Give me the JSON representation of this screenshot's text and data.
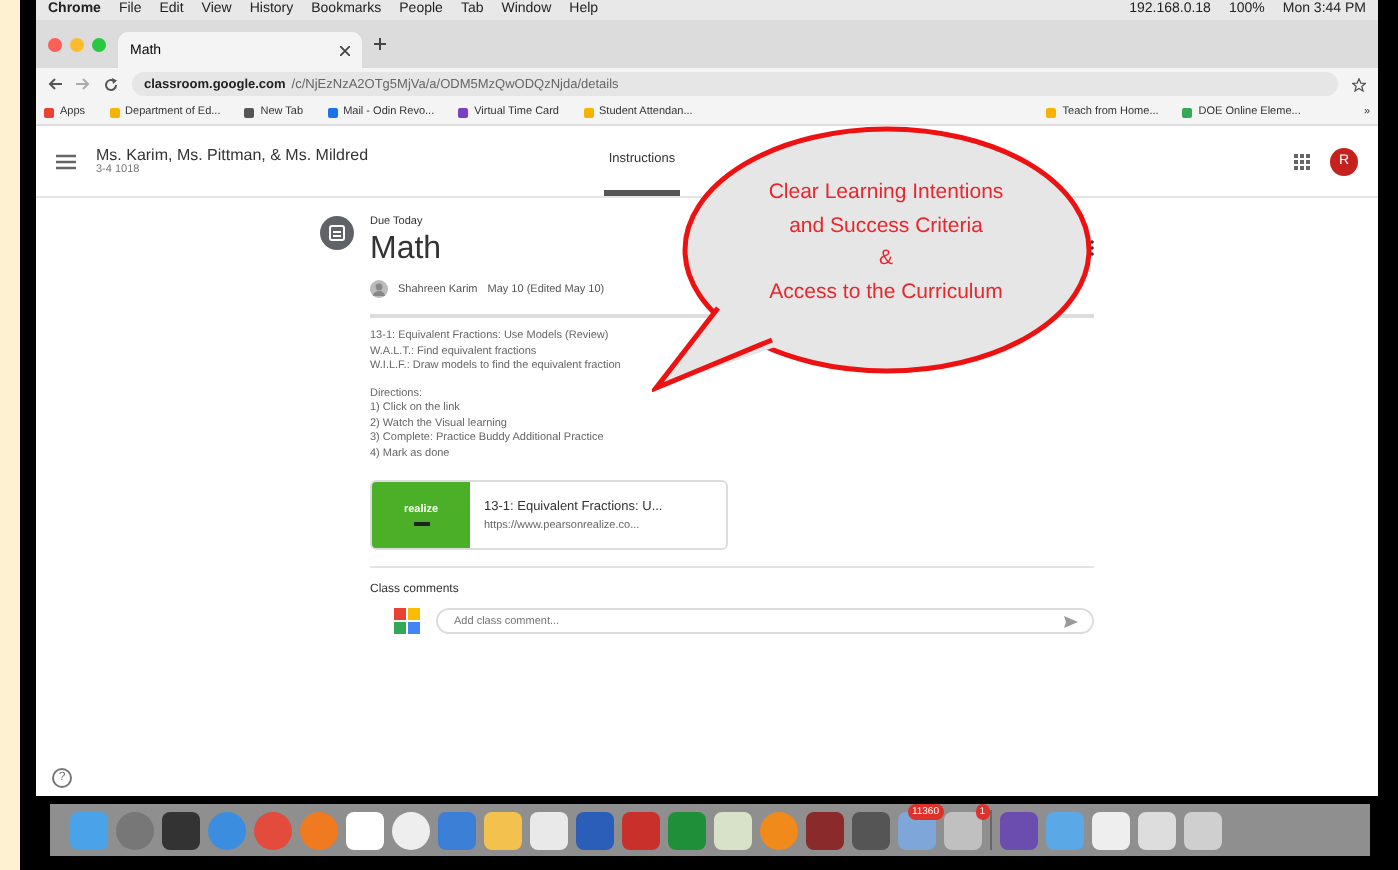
{
  "menu_bar": {
    "items": [
      "Chrome",
      "File",
      "Edit",
      "View",
      "History",
      "Bookmarks",
      "People",
      "Tab",
      "Window",
      "Help"
    ],
    "status": [
      "192.168.0.18",
      "100%",
      "Mon 3:44 PM"
    ]
  },
  "browser": {
    "tab_title": "Math",
    "url_host": "classroom.google.com",
    "url_path": "/c/NjEzNzA2OTg5MjVa/a/ODM5MzQwODQzNjda/details",
    "bookmarks": [
      "Apps",
      "Department of Ed...",
      "New Tab",
      "Mail - Odin Revo...",
      "Virtual Time Card",
      "Student Attendan...",
      "Teach from Home...",
      "DOE Online Eleme..."
    ],
    "more": "»"
  },
  "classroom": {
    "class_name": "Ms. Karim, Ms. Pittman, & Ms. Mildred",
    "section": "3-4 1018",
    "tabs": [
      {
        "label": "Instructions",
        "selected": true
      }
    ],
    "avatar": "R"
  },
  "post": {
    "due": "Due Today",
    "title": "Math",
    "author": "Shahreen Karim",
    "date": "May 10 (Edited May 10)",
    "lines": [
      "13-1: Equivalent Fractions: Use Models (Review)",
      "W.A.L.T.: Find equivalent fractions",
      "W.I.L.F.: Draw models to find the equivalent fraction"
    ],
    "directions": [
      "Directions:",
      "1) Click on the link",
      "2) Watch the Visual learning",
      "3) Complete: Practice Buddy Additional Practice",
      "4) Mark as done"
    ],
    "attachment": {
      "logo": "realize",
      "title": "13-1: Equivalent Fractions: U...",
      "url": "https://www.pearsonrealize.co..."
    },
    "comments_label": "Class comments",
    "comment_placeholder": "Add class comment...",
    "help": "?"
  },
  "callout": [
    "Clear Learning Intentions",
    "and Success Criteria",
    "&",
    "Access to the Curriculum"
  ],
  "dock": {
    "mail_badge": "11360",
    "printer_badge": "1"
  }
}
